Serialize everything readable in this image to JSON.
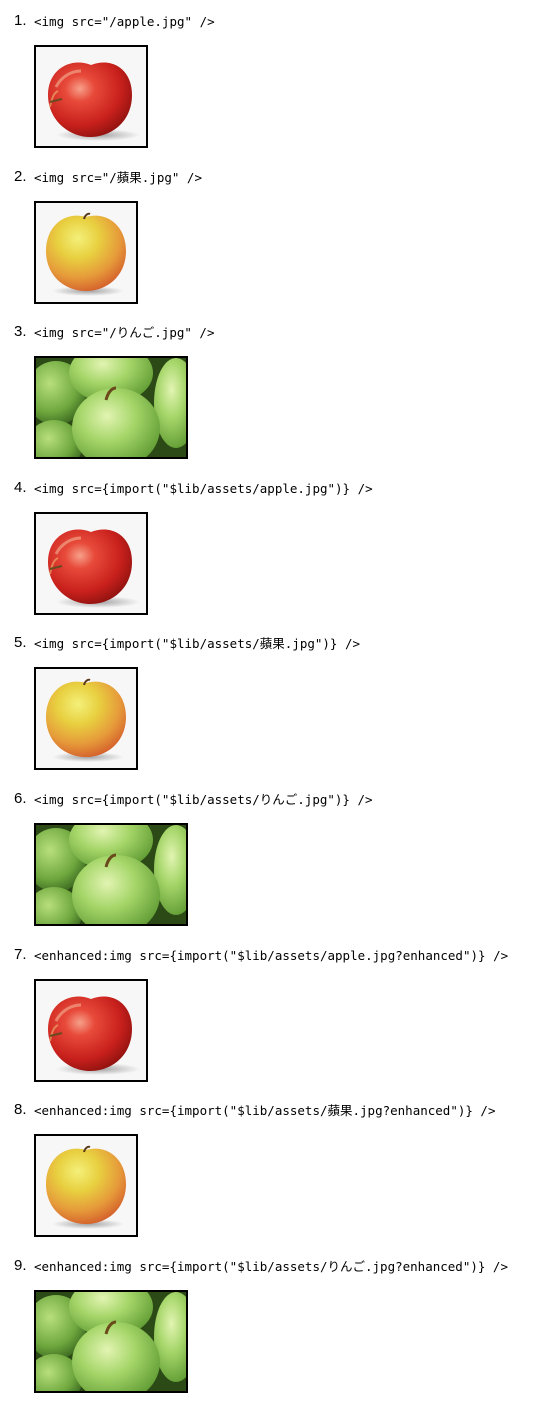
{
  "items": [
    {
      "number": "1.",
      "code": "<img src=\"/apple.jpg\" />",
      "image": "red-apple"
    },
    {
      "number": "2.",
      "code": "<img src=\"/蘋果.jpg\" />",
      "image": "yellow-apple"
    },
    {
      "number": "3.",
      "code": "<img src=\"/りんご.jpg\" />",
      "image": "green-apples"
    },
    {
      "number": "4.",
      "code": "<img src={import(\"$lib/assets/apple.jpg\")} />",
      "image": "red-apple"
    },
    {
      "number": "5.",
      "code": "<img src={import(\"$lib/assets/蘋果.jpg\")} />",
      "image": "yellow-apple"
    },
    {
      "number": "6.",
      "code": "<img src={import(\"$lib/assets/りんご.jpg\")} />",
      "image": "green-apples"
    },
    {
      "number": "7.",
      "code": "<enhanced:img src={import(\"$lib/assets/apple.jpg?enhanced\")} />",
      "image": "red-apple"
    },
    {
      "number": "8.",
      "code": "<enhanced:img src={import(\"$lib/assets/蘋果.jpg?enhanced\")} />",
      "image": "yellow-apple"
    },
    {
      "number": "9.",
      "code": "<enhanced:img src={import(\"$lib/assets/りんご.jpg?enhanced\")} />",
      "image": "green-apples"
    }
  ]
}
